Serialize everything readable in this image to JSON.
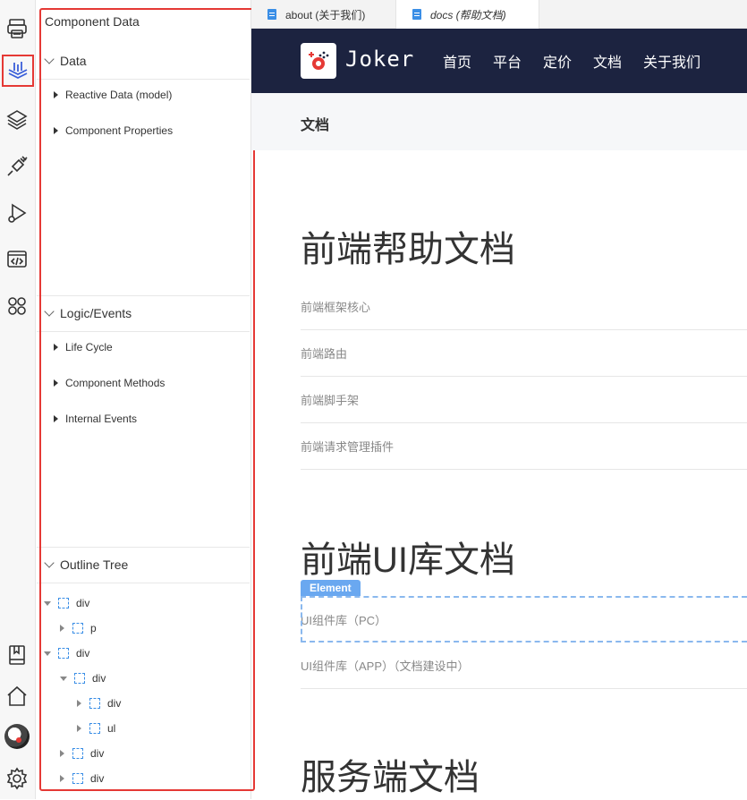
{
  "tabs": [
    {
      "label": "about (关于我们)"
    },
    {
      "label": "docs (帮助文档)"
    }
  ],
  "panel": {
    "title": "Component Data",
    "sections": {
      "data": {
        "title": "Data",
        "items": [
          "Reactive Data (model)",
          "Component Properties"
        ]
      },
      "logic": {
        "title": "Logic/Events",
        "items": [
          "Life Cycle",
          "Component Methods",
          "Internal Events"
        ]
      },
      "outline": {
        "title": "Outline Tree",
        "nodes": [
          "div",
          "p",
          "div",
          "div",
          "div",
          "ul",
          "div",
          "div"
        ]
      }
    }
  },
  "activity_icons": [
    "printer-icon",
    "data-chart-icon",
    "layers-icon",
    "plugin-icon",
    "debug-run-icon",
    "code-icon",
    "apps-icon",
    "book-icon",
    "home-icon",
    "avatar",
    "settings-icon"
  ],
  "site": {
    "logo_text": "Joker",
    "nav": [
      "首页",
      "平台",
      "定价",
      "文档",
      "关于我们"
    ],
    "subbar_title": "文档",
    "sections": [
      {
        "heading": "前端帮助文档",
        "links": [
          "前端框架核心",
          "前端路由",
          "前端脚手架",
          "前端请求管理插件"
        ]
      },
      {
        "heading": "前端UI库文档",
        "links": [
          "UI组件库（PC）",
          "UI组件库（APP）（文档建设中）"
        ]
      },
      {
        "heading": "服务端文档"
      }
    ],
    "element_tag": "Element"
  },
  "colors": {
    "header_bg": "#1c2340",
    "accent_blue": "#3a8ee6",
    "highlight_red": "#e53935"
  }
}
